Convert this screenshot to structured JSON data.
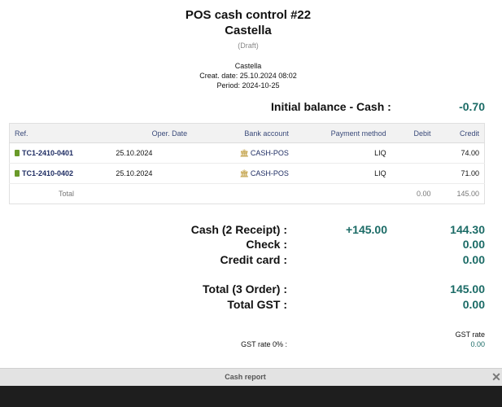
{
  "header": {
    "title": "POS cash control #22",
    "subtitle": "Castella",
    "status": "(Draft)",
    "terminal": "Castella",
    "creation_date": "Creat. date: 25.10.2024 08:02",
    "period": "Period: 2024-10-25"
  },
  "initial_balance": {
    "label": "Initial balance - Cash :",
    "value": "-0.70"
  },
  "table": {
    "columns": [
      "Ref.",
      "Oper. Date",
      "Bank account",
      "Payment method",
      "Debit",
      "Credit"
    ],
    "rows": [
      {
        "ref": "TC1-2410-0401",
        "date": "25.10.2024",
        "bank": "CASH-POS",
        "method": "LIQ",
        "debit": "",
        "credit": "74.00"
      },
      {
        "ref": "TC1-2410-0402",
        "date": "25.10.2024",
        "bank": "CASH-POS",
        "method": "LIQ",
        "debit": "",
        "credit": "71.00"
      }
    ],
    "total": {
      "label": "Total",
      "debit": "0.00",
      "credit": "145.00"
    }
  },
  "summary": {
    "cash": {
      "label": "Cash (2 Receipt) :",
      "mid": "+145.00",
      "value": "144.30"
    },
    "check": {
      "label": "Check :",
      "value": "0.00"
    },
    "credit_card": {
      "label": "Credit card :",
      "value": "0.00"
    },
    "total": {
      "label": "Total (3 Order) :",
      "value": "145.00"
    },
    "total_gst": {
      "label": "Total GST :",
      "value": "0.00"
    }
  },
  "gst": {
    "header": "GST rate",
    "label": "GST rate 0% :",
    "value": "0.00"
  },
  "footer": {
    "title": "Cash report"
  },
  "colors": {
    "accent": "#1b6b66",
    "link": "#1f2d63"
  }
}
